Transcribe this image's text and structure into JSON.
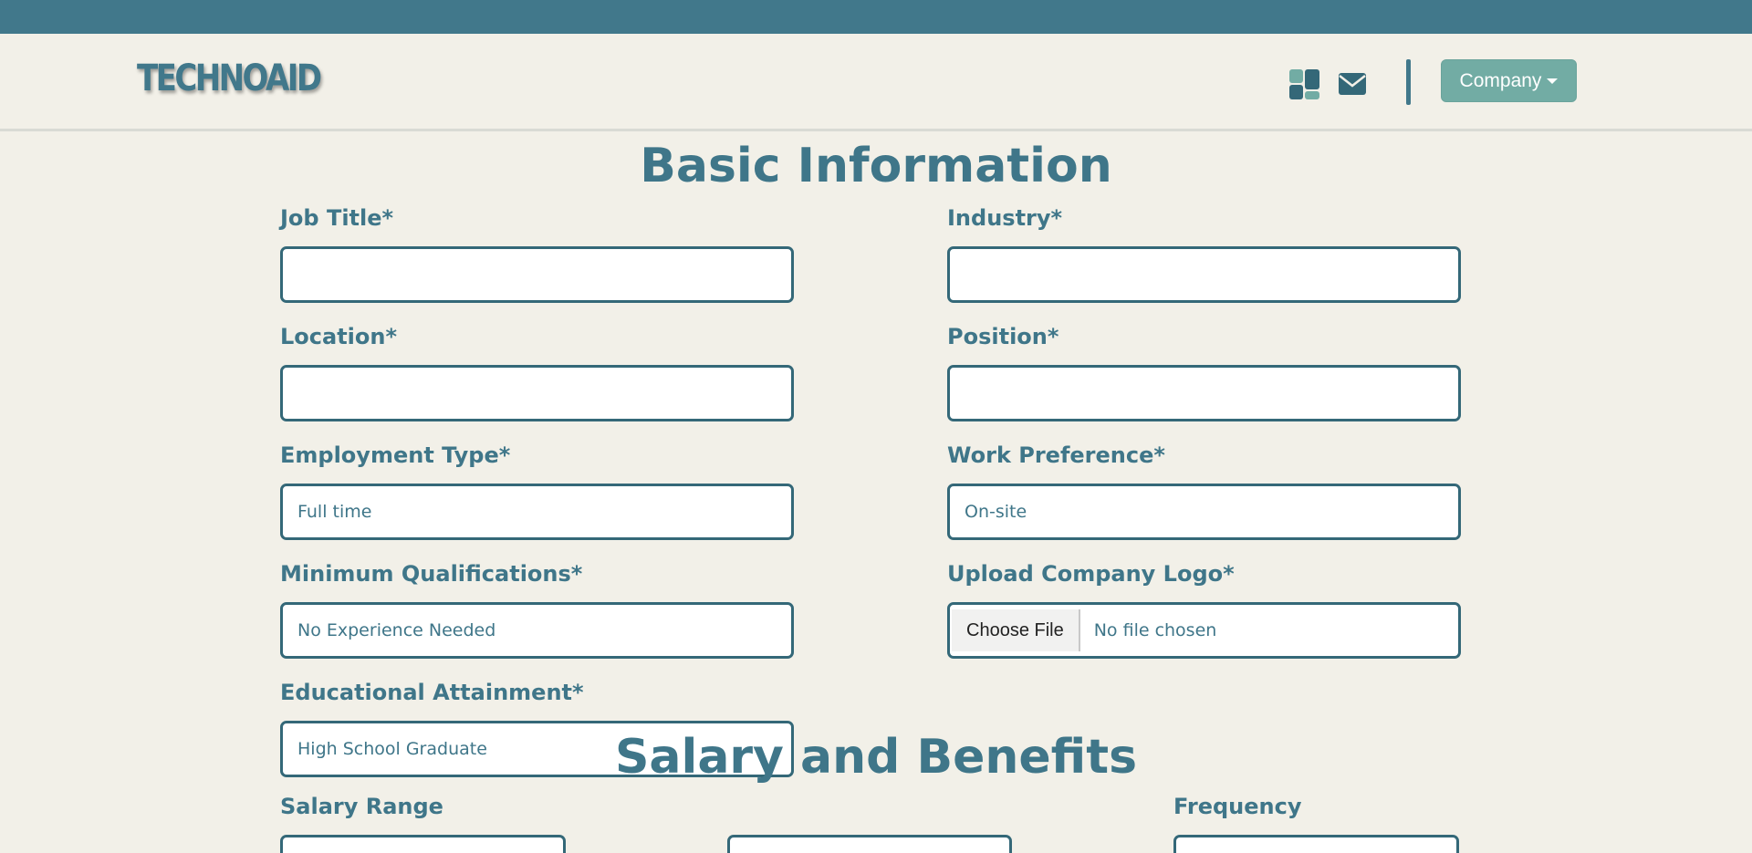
{
  "header": {
    "logo": "TECHNOAID",
    "company_button": "Company",
    "icons": [
      "dashboard-icon",
      "envelope-icon"
    ]
  },
  "colors": {
    "primary": "#41788b",
    "accent": "#72aca4",
    "background": "#f2f0e8"
  },
  "basic_info": {
    "title": "Basic Information",
    "job_title_label": "Job Title*",
    "industry_label": "Industry*",
    "location_label": "Location*",
    "position_label": "Position*",
    "employment_type_label": "Employment Type*",
    "employment_type_value": "Full time",
    "work_preference_label": "Work Preference*",
    "work_preference_value": "On-site",
    "min_qualifications_label": "Minimum Qualifications*",
    "min_qualifications_value": "No Experience Needed",
    "upload_logo_label": "Upload Company Logo*",
    "choose_file": "Choose File",
    "no_file": "No file chosen",
    "education_label": "Educational Attainment*",
    "education_value": "High School Graduate"
  },
  "salary": {
    "title": "Salary and Benefits",
    "salary_range_label": "Salary Range",
    "frequency_label": "Frequency"
  }
}
